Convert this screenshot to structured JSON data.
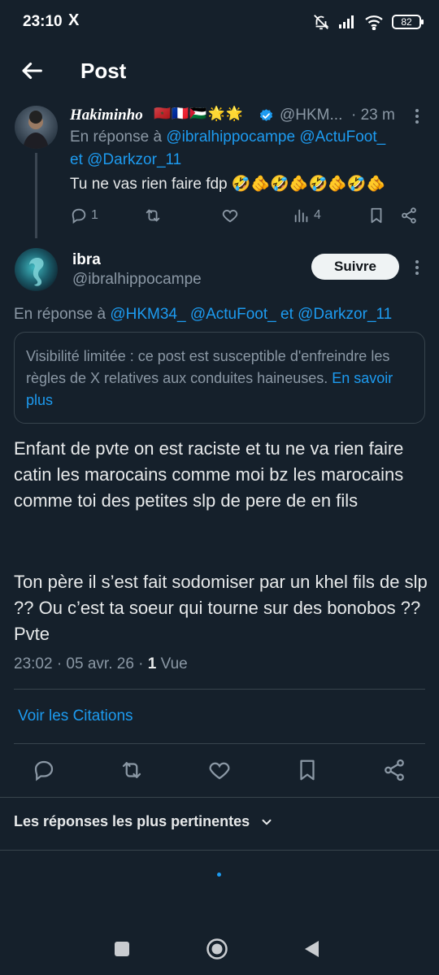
{
  "status": {
    "time": "23:10",
    "app_icon": "X",
    "battery": "82"
  },
  "header": {
    "title": "Post"
  },
  "parent_tweet": {
    "name": "Hakiminho",
    "flags": "🇲🇦🇫🇷🇵🇸🌟🌟",
    "handle": "@HKM...",
    "time": "· 23 m",
    "reply_prefix": "En réponse à",
    "reply_to_1": "@ibralhippocampe",
    "reply_to_2": "@ActuFoot_",
    "reply_and": "et",
    "reply_to_3": "@Darkzor_11",
    "text": "Tu ne vas rien faire fdp 🤣🫵🤣🫵🤣🫵🤣🫵",
    "replies": "1",
    "views": "4"
  },
  "main_tweet": {
    "name": "ibra",
    "handle": "@ibralhippocampe",
    "follow_label": "Suivre",
    "reply_prefix": "En réponse à",
    "reply_to_1": "@HKM34_",
    "reply_to_2": "@ActuFoot_",
    "reply_and": "et",
    "reply_to_3": "@Darkzor_11",
    "notice_text": "Visibilité limitée : ce post est susceptible d'enfreindre les règles de X relatives aux conduites haineuses.",
    "notice_link": "En savoir plus",
    "paragraph_1": "Enfant de pvte on est raciste et tu ne va rien faire catin les marocains comme moi bz les marocains comme toi des petites slp de pere de en fils",
    "paragraph_2": "Ton père il s’est fait sodomiser par un khel fils de slp ?? Ou c’est ta soeur qui tourne sur des bonobos ?? Pvte",
    "meta_time": "23:02 · 05 avr. 26 · ",
    "views_count": "1",
    "views_label": "Vue",
    "quotes_link": "Voir les Citations"
  },
  "replies_sort": {
    "label": "Les réponses les plus pertinentes"
  },
  "colors": {
    "background": "#15202b",
    "accent": "#1d9bf0",
    "muted": "#8b98a5"
  }
}
